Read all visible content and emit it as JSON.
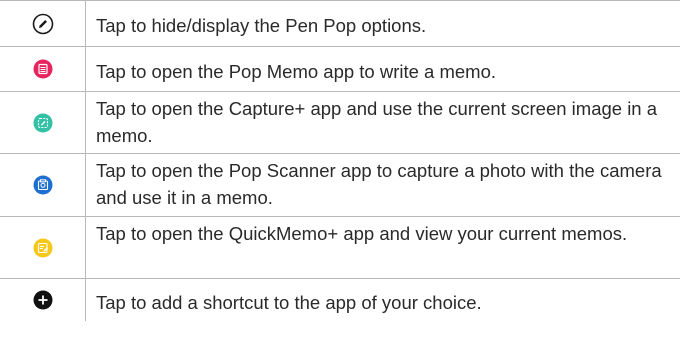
{
  "rows": [
    {
      "icon": "pen-toggle-icon",
      "color": "#1a1a1a",
      "text": "Tap to hide/display the Pen Pop options."
    },
    {
      "icon": "pop-memo-icon",
      "color": "#e8245f",
      "text": "Tap to open the Pop Memo app to write a memo."
    },
    {
      "icon": "capture-plus-icon",
      "color": "#33c1a6",
      "text": "Tap to open the Capture+ app and use the current screen image in a memo."
    },
    {
      "icon": "pop-scanner-icon",
      "color": "#1f6fd1",
      "text": "Tap to open the Pop Scanner app to capture a photo with the camera and use it in a memo."
    },
    {
      "icon": "quickmemo-icon",
      "color": "#f7c81c",
      "text": "Tap to open the QuickMemo+ app and view your current memos."
    },
    {
      "icon": "add-shortcut-icon",
      "color": "#111111",
      "text": "Tap to add a shortcut to the app of your choice."
    }
  ]
}
